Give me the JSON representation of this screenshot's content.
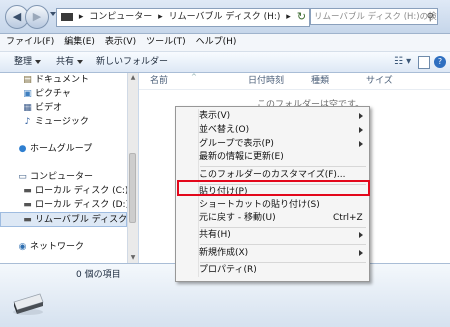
{
  "address_bar": {
    "path_root": "コンピューター",
    "path_current": "リムーバブル ディスク (H:)",
    "search_placeholder": "リムーバブル ディスク (H:)の検索"
  },
  "menu": [
    "ファイル(F)",
    "編集(E)",
    "表示(V)",
    "ツール(T)",
    "ヘルプ(H)"
  ],
  "toolbar": {
    "organize": "整理",
    "share": "共有",
    "new_folder": "新しいフォルダー"
  },
  "nav_pane": {
    "libraries": [
      "ドキュメント",
      "ピクチャ",
      "ビデオ",
      "ミュージック"
    ],
    "homegroup": "ホームグループ",
    "computer": "コンピューター",
    "drives": [
      "ローカル ディスク (C:)",
      "ローカル ディスク (D:)",
      "リムーバブル ディスク (H:)"
    ],
    "network": "ネットワーク"
  },
  "columns": [
    "名前",
    "日付時刻",
    "種類",
    "サイズ"
  ],
  "empty_message": "このフォルダーは空です。",
  "status": {
    "item_count": "0 個の項目"
  },
  "context_menu": {
    "view": "表示(V)",
    "sort": "並べ替え(O)",
    "group": "グループで表示(P)",
    "refresh": "最新の情報に更新(E)",
    "customize": "このフォルダーのカスタマイズ(F)...",
    "paste": "貼り付け(P)",
    "paste_shortcut": "ショートカットの貼り付け(S)",
    "undo": "元に戻す - 移動(U)",
    "undo_shortcut": "Ctrl+Z",
    "share": "共有(H)",
    "new": "新規作成(X)",
    "properties": "プロパティ(R)"
  },
  "colors": {
    "highlight": "#e3071b",
    "frame": "#c9d8ea"
  }
}
